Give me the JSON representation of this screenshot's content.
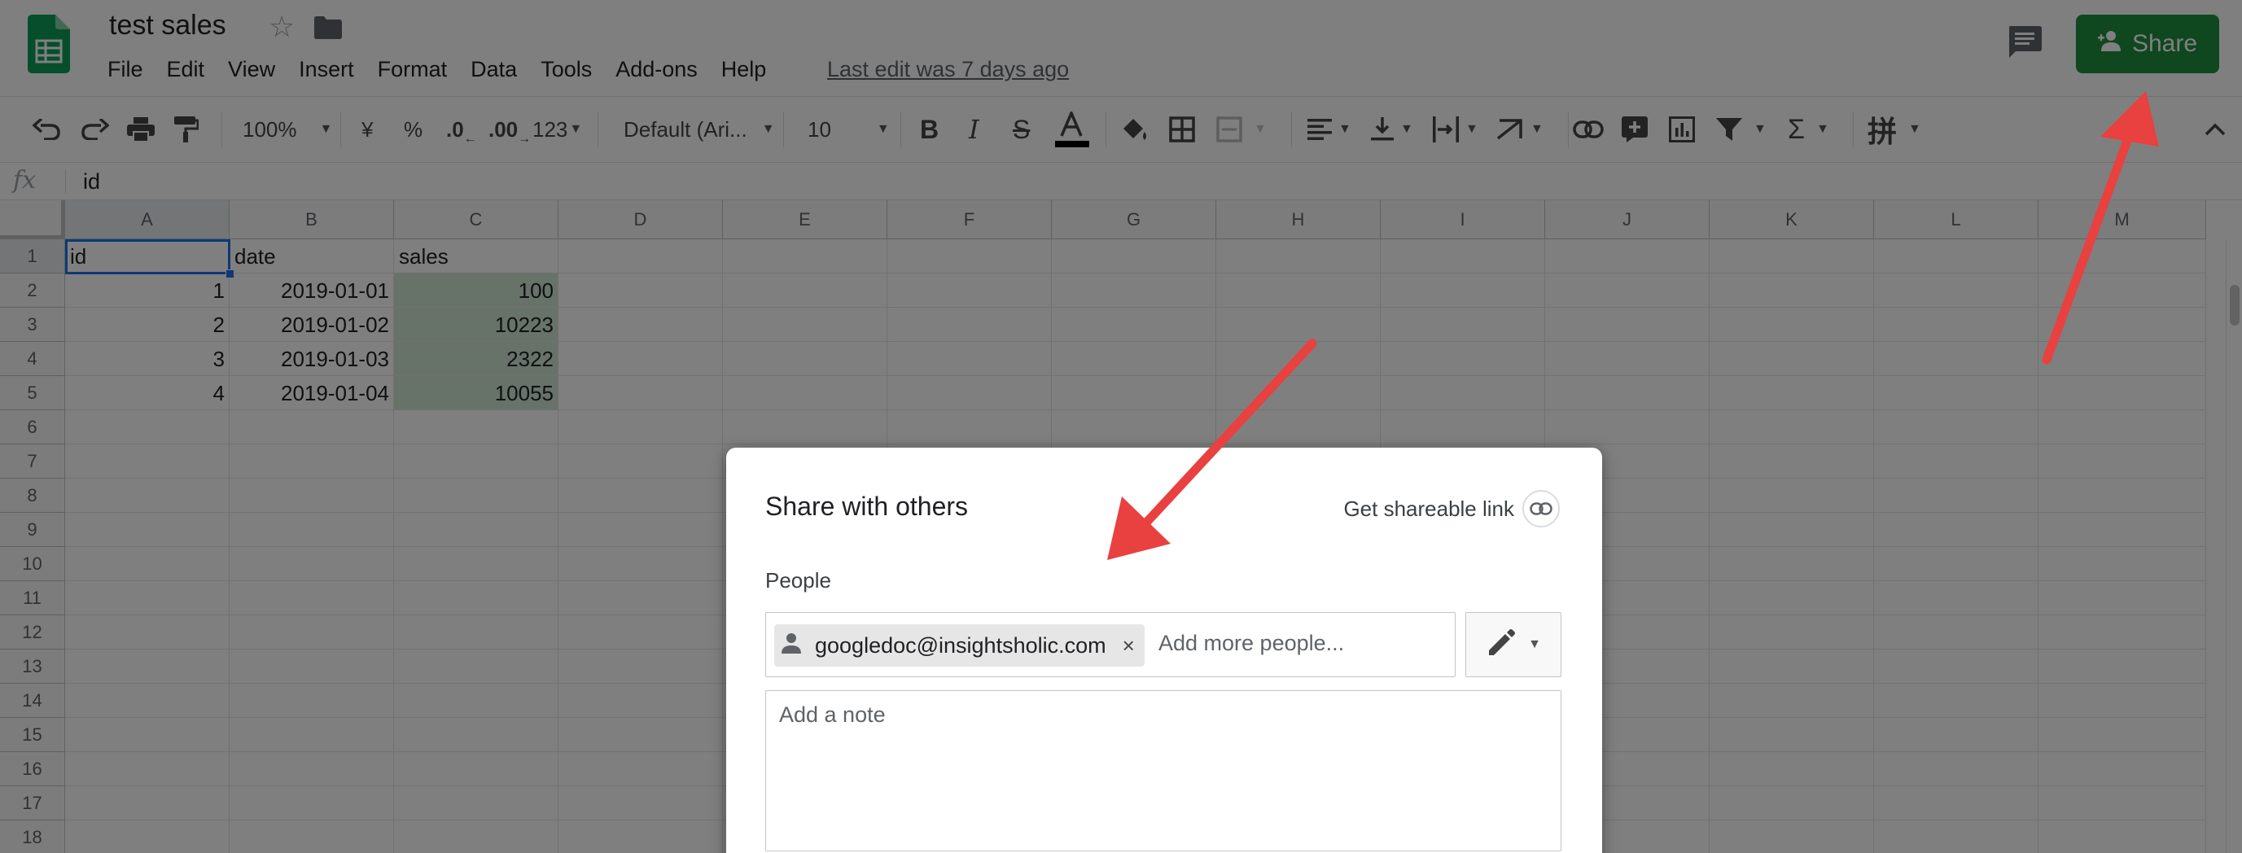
{
  "doc": {
    "title": "test sales",
    "last_edit": "Last edit was 7 days ago"
  },
  "menu": [
    "File",
    "Edit",
    "View",
    "Insert",
    "Format",
    "Data",
    "Tools",
    "Add-ons",
    "Help"
  ],
  "header": {
    "share_label": "Share"
  },
  "toolbar": {
    "zoom": "100%",
    "currency": "¥",
    "percent": "%",
    "dec_decrease": ".0",
    "dec_increase": ".00",
    "more_formats": "123",
    "font": "Default (Ari...",
    "font_size": "10"
  },
  "formula_bar": {
    "fx": "fx",
    "value": "id"
  },
  "grid": {
    "columns": [
      "A",
      "B",
      "C",
      "D",
      "E",
      "F",
      "G",
      "H",
      "I",
      "J",
      "K",
      "L",
      "M"
    ],
    "rows": [
      "1",
      "2",
      "3",
      "4",
      "5",
      "6",
      "7",
      "8",
      "9",
      "10",
      "11",
      "12",
      "13",
      "14",
      "15",
      "16",
      "17",
      "18"
    ],
    "cells": {
      "a1": "id",
      "b1": "date",
      "c1": "sales",
      "a2": "1",
      "b2": "2019-01-01",
      "c2": "100",
      "a3": "2",
      "b3": "2019-01-02",
      "c3": "10223",
      "a4": "3",
      "b4": "2019-01-03",
      "c4": "2322",
      "a5": "4",
      "b5": "2019-01-04",
      "c5": "10055"
    }
  },
  "dialog": {
    "title": "Share with others",
    "get_link": "Get shareable link",
    "people_label": "People",
    "chip_email": "googledoc@insightsholic.com",
    "chip_close": "×",
    "add_people_placeholder": "Add more people...",
    "note_placeholder": "Add a note"
  },
  "colors": {
    "share_button": "#1e8e3e",
    "selection_fill": "#cfe6d2",
    "active_border": "#1a73e8",
    "annotation_arrow": "#e8413f"
  }
}
